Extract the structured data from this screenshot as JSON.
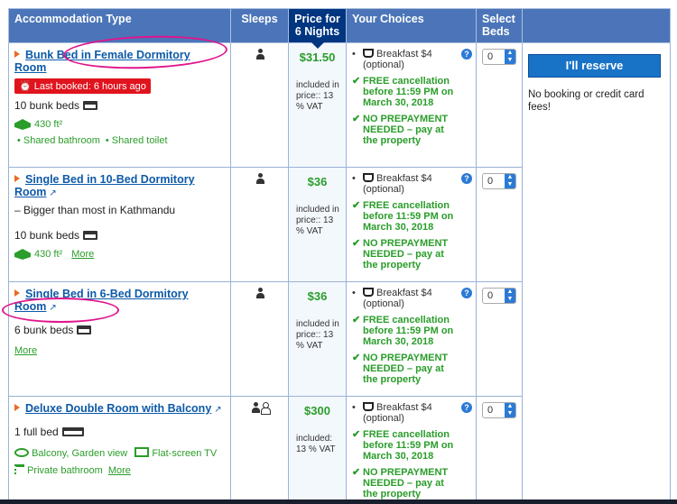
{
  "headers": {
    "accommodation": "Accommodation Type",
    "sleeps": "Sleeps",
    "price": "Price for 6 Nights",
    "choices": "Your Choices",
    "select": "Select Beds"
  },
  "rooms": [
    {
      "name": "Bunk Bed in Female Dormitory Room",
      "badge": "Last booked: 6 hours ago",
      "beds": "10 bunk beds",
      "size": "430 ft²",
      "facilities": [
        "Shared bathroom",
        "Shared toilet"
      ],
      "price": "$31.50",
      "price_note": "included in price:: 13 % VAT",
      "select_value": "0"
    },
    {
      "name": "Single Bed in 10-Bed Dormitory Room",
      "desc": "– Bigger than most in Kathmandu",
      "beds": "10 bunk beds",
      "size": "430 ft²",
      "more": "More",
      "price": "$36",
      "price_note": "included in price:: 13 % VAT",
      "select_value": "0"
    },
    {
      "name": "Single Bed in 6-Bed Dormitory Room",
      "beds": "6 bunk beds",
      "more": "More",
      "price": "$36",
      "price_note": "included in price:: 13 % VAT",
      "select_value": "0"
    },
    {
      "name": "Deluxe Double Room with Balcony",
      "beds": "1 full bed",
      "fac_view": "Balcony, Garden view",
      "fac_tv": "Flat-screen TV",
      "fac_bath": "Private bathroom",
      "more": "More",
      "price": "$300",
      "price_note": "included: 13 % VAT",
      "select_value": "0"
    }
  ],
  "choices": {
    "breakfast": "Breakfast $4",
    "optional": "(optional)",
    "cancel": "FREE cancellation before 11:59 PM on March 30, 2018",
    "prepay": "NO PREPAYMENT NEEDED – pay at the property",
    "help": "?"
  },
  "reserve": {
    "button": "I'll reserve",
    "note": "No booking or credit card fees!"
  },
  "colors": {
    "header": "#4b75b8",
    "price_header": "#003580",
    "green": "#2a9d2a",
    "link": "#0d5aa8",
    "annotation": "#e0158c",
    "badge": "#e0141e"
  }
}
